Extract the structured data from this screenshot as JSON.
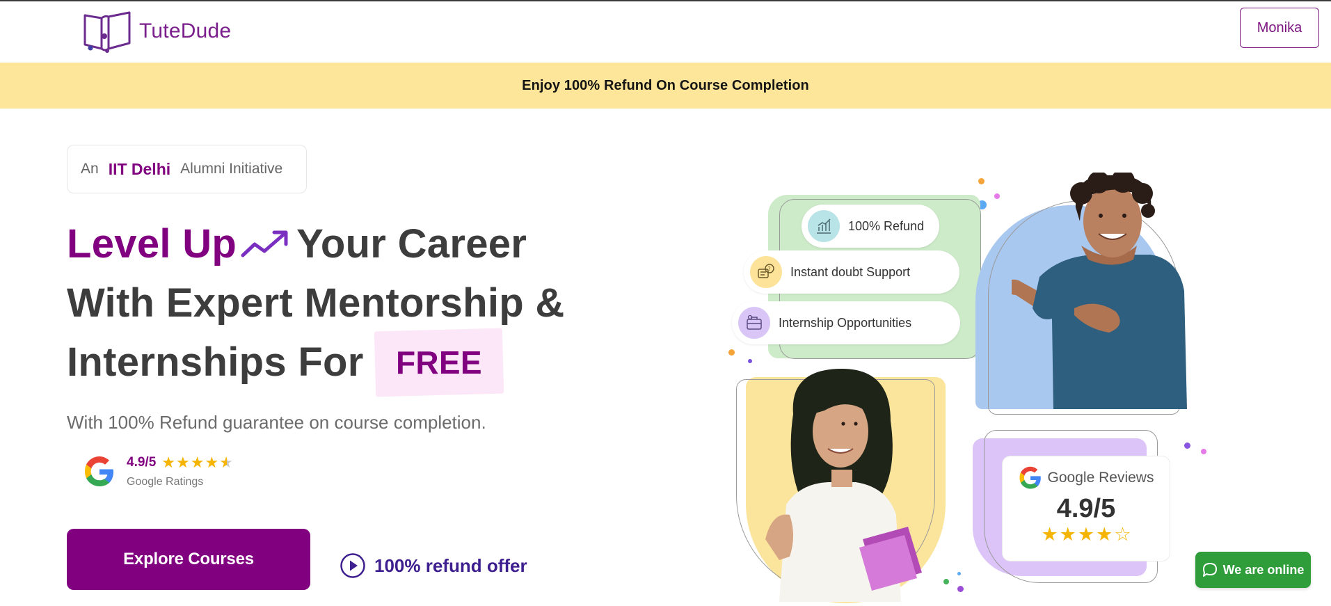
{
  "header": {
    "logo_text": "TuteDude",
    "user_button": "Monika"
  },
  "banner": {
    "text": "Enjoy 100% Refund On Course Completion"
  },
  "hero": {
    "pill": {
      "prefix": "An",
      "highlight": "IIT Delhi",
      "suffix": "Alumni Initiative"
    },
    "headline": {
      "accent": "Level Up",
      "line1_rest": "Your Career",
      "line2": "With Expert Mentorship &",
      "line3": "Internships For",
      "free": "FREE"
    },
    "subheading": "With 100% Refund guarantee on course completion.",
    "rating": {
      "value": "4.9/5",
      "label": "Google Ratings",
      "stars": 4.5
    },
    "cta_primary": "Explore Courses",
    "cta_secondary": "100% refund offer"
  },
  "collage": {
    "features": [
      {
        "label": "100% Refund",
        "icon": "chart-icon"
      },
      {
        "label": "Instant doubt Support",
        "icon": "doubt-icon"
      },
      {
        "label": "Internship Opportunities",
        "icon": "briefcase-icon"
      }
    ],
    "reviews": {
      "title": "Google Reviews",
      "score": "4.9/5",
      "stars": 4
    }
  },
  "chat": {
    "label": "We are online"
  },
  "colors": {
    "brand": "#800080",
    "banner": "#fde59a",
    "chat": "#2e9d3a",
    "star": "#f5b400"
  }
}
